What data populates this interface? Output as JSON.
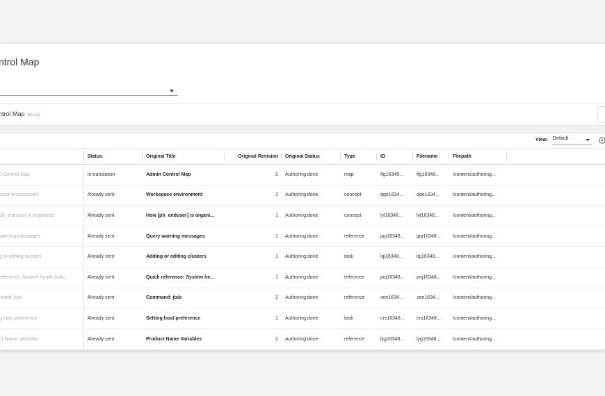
{
  "page": {
    "title": "ntrol Map"
  },
  "card": {
    "title": "ntrol Map",
    "language": "(cs-cz)"
  },
  "toolbar": {
    "view_label": "View:",
    "view_value": "Default"
  },
  "table": {
    "headers": [
      "",
      "Status",
      "Original Title",
      "Original Revision",
      "Original Status",
      "Type",
      "ID",
      "Filename",
      "Filepath",
      ""
    ],
    "rows": [
      [
        "n Control Map",
        "In translation",
        "Admin Control Map",
        "2",
        "Authoring:done",
        "map",
        "ffg16348...",
        "ffg16348...",
        "/content/authoring...",
        ""
      ],
      [
        "pace environment",
        "Already sent",
        "Workspace environment",
        "1",
        "Authoring:done",
        "concept",
        "qqe1634...",
        "qqe1634...",
        "/content/authoring...",
        ""
      ],
      [
        "ph_enduser] is organized",
        "Already sent",
        "How [ph_enduser] is organi...",
        "1",
        "Authoring:done",
        "concept",
        "lyl16348...",
        "lyl16348...",
        "/content/authoring...",
        ""
      ],
      [
        "warning messages",
        "Already sent",
        "Query warning messages",
        "1",
        "Authoring:done",
        "reference",
        "jpp16348...",
        "jpp16348...",
        "/content/authoring...",
        ""
      ],
      [
        "g or editing clusters",
        "Already sent",
        "Adding or editing clusters",
        "1",
        "Authoring:done",
        "task",
        "lqj16348...",
        "lqj16348...",
        "/content/authoring...",
        ""
      ],
      [
        "reference: System health indic...",
        "Already sent",
        "Quick reference: System he...",
        "1",
        "Authoring:done",
        "reference",
        "poj16348...",
        "poj16348...",
        "/content/authoring...",
        ""
      ],
      [
        "mand: jtub",
        "Already sent",
        "Command: jtub",
        "2",
        "Authoring:done",
        "reference",
        "xee1634...",
        "xee1634...",
        "/content/authoring...",
        ""
      ],
      [
        "g host preference",
        "Already sent",
        "Setting host preference",
        "1",
        "Authoring:done",
        "task",
        "crs16348...",
        "crs16348...",
        "/content/authoring...",
        ""
      ],
      [
        "ct Name Variables",
        "Already sent",
        "Product Name Variables",
        "2",
        "Authoring:done",
        "reference",
        "lyg16348...",
        "lyg16348...",
        "/content/authoring...",
        ""
      ]
    ]
  }
}
